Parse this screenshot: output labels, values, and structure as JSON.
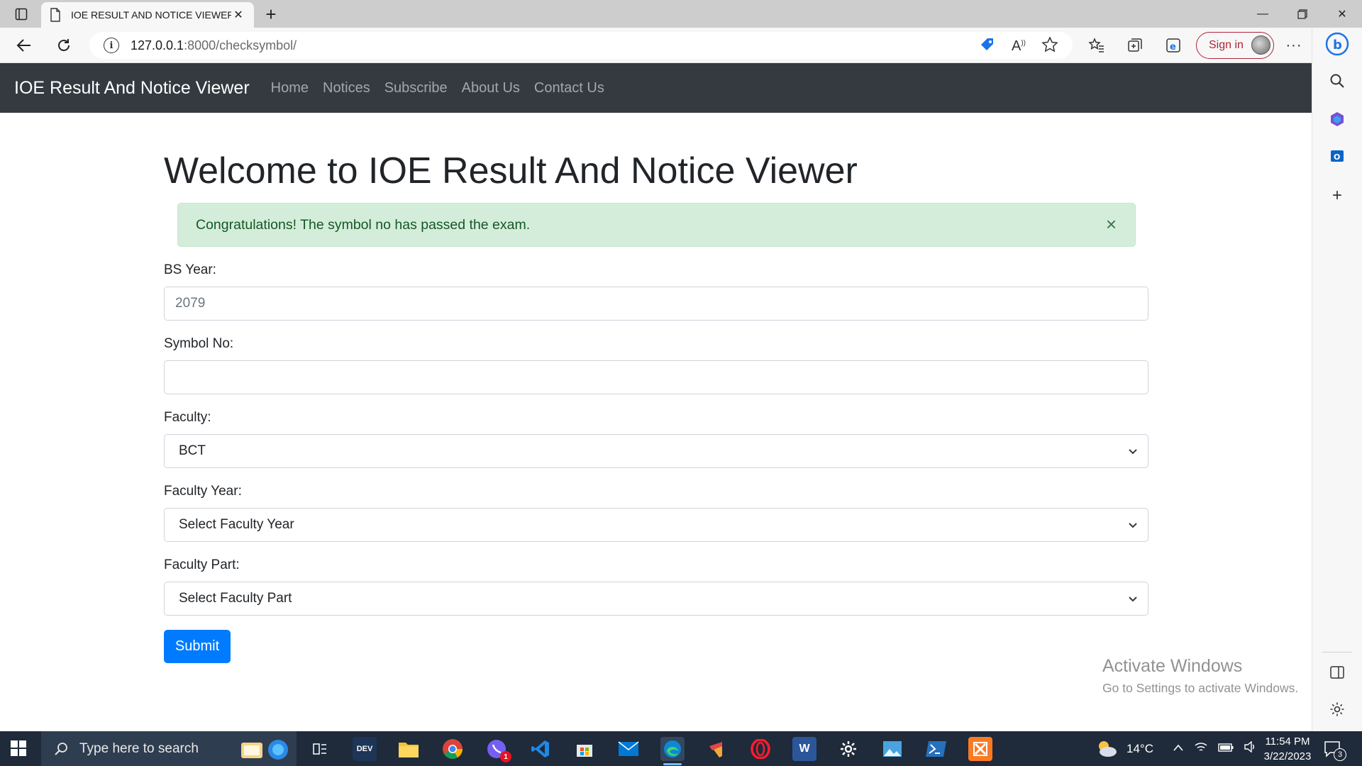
{
  "browser": {
    "tab_title": "IOE RESULT AND NOTICE VIEWER",
    "url_host": "127.0.0.1",
    "url_path": ":8000/checksymbol/",
    "sign_in_label": "Sign in"
  },
  "navbar": {
    "brand": "IOE Result And Notice Viewer",
    "links": [
      "Home",
      "Notices",
      "Subscribe",
      "About Us",
      "Contact Us"
    ]
  },
  "main": {
    "title": "Welcome to IOE Result And Notice Viewer",
    "alert_text": "Congratulations! The symbol no has passed the exam.",
    "alert_close": "×",
    "bs_year_label": "BS Year:",
    "bs_year_placeholder": "2079",
    "symbol_label": "Symbol No:",
    "symbol_value": "",
    "faculty_label": "Faculty:",
    "faculty_selected": "BCT",
    "faculty_year_label": "Faculty Year:",
    "faculty_year_selected": "Select Faculty Year",
    "faculty_part_label": "Faculty Part:",
    "faculty_part_selected": "Select Faculty Part",
    "submit_label": "Submit"
  },
  "watermark": {
    "line1": "Activate Windows",
    "line2": "Go to Settings to activate Windows."
  },
  "taskbar": {
    "search_placeholder": "Type here to search",
    "weather": "14°C",
    "time": "11:54 PM",
    "date": "3/22/2023",
    "notification_count": "3",
    "chat_badge": "1"
  },
  "colors": {
    "navbar_bg": "#343a40",
    "alert_bg": "#d4edda",
    "alert_text": "#155724",
    "primary": "#007bff",
    "taskbar_bg": "#1f2a3a"
  }
}
